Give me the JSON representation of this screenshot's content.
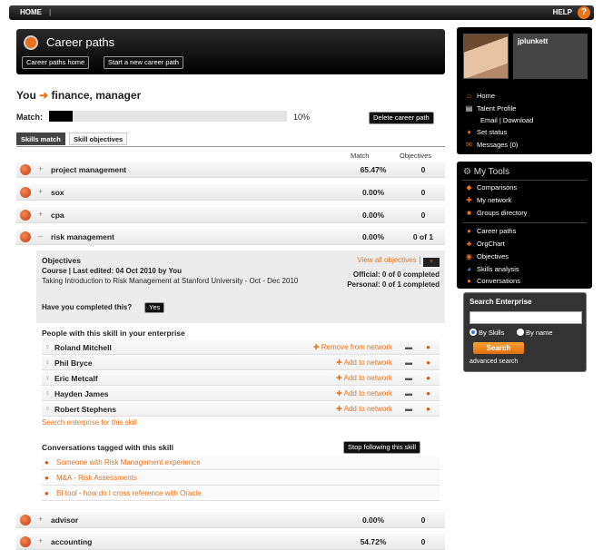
{
  "topbar": {
    "home": "HOME",
    "help": "HELP",
    "help_icon": "?"
  },
  "career": {
    "title": "Career paths",
    "btn_home": "Career paths home",
    "btn_new": "Start a new career path"
  },
  "you": {
    "label": "You",
    "arrow": "➜",
    "role": "finance, manager"
  },
  "match": {
    "label": "Match:",
    "percent": "10%",
    "fraction": 0.1,
    "delete_btn": "Delete career path"
  },
  "tabs": {
    "skills_match": "Skills match",
    "skill_objectives": "Skill objectives"
  },
  "columns": {
    "match": "Match",
    "objectives": "Objectives"
  },
  "skills_top": [
    {
      "pm": "+",
      "name": "project management",
      "match": "65.47%",
      "obj": "0"
    },
    {
      "pm": "+",
      "name": "sox",
      "match": "0.00%",
      "obj": "0"
    },
    {
      "pm": "+",
      "name": "cpa",
      "match": "0.00%",
      "obj": "0"
    },
    {
      "pm": "–",
      "name": "risk management",
      "match": "0.00%",
      "obj": "0 of 1"
    }
  ],
  "objectives": {
    "title": "Objectives",
    "view_all": "View all objectives",
    "view_sep": "|",
    "course_line": "Course | Last edited: 04 Oct 2010 by You",
    "desc": "Taking Introduction to Risk Management at Stanford University - Oct - Dec 2010",
    "official": "Official: 0 of 0 completed",
    "personal": "Personal: 0 of 1 completed",
    "question": "Have you completed this?",
    "yes_btn": "Yes"
  },
  "people": {
    "title": "People with this skill in your enterprise",
    "list": [
      {
        "name": "Roland Mitchell",
        "action": "Remove from network"
      },
      {
        "name": "Phil Bryce",
        "action": "Add to network"
      },
      {
        "name": "Eric Metcalf",
        "action": "Add to network"
      },
      {
        "name": "Hayden James",
        "action": "Add to network"
      },
      {
        "name": "Robert Stephens",
        "action": "Add to network"
      }
    ],
    "search_link": "Search enterprise for this skill"
  },
  "conversations": {
    "title": "Conversations tagged with this skill",
    "stop_btn": "Stop following this skill",
    "list": [
      "Someone with Risk Management experience",
      "M&A - Risk Assessments",
      "BI tool - how do I cross reference with Oracle"
    ]
  },
  "skills_bottom": [
    {
      "pm": "+",
      "name": "advisor",
      "match": "0.00%",
      "obj": "0"
    },
    {
      "pm": "+",
      "name": "accounting",
      "match": "54.72%",
      "obj": "0"
    }
  ],
  "profile": {
    "username": "jplunkett",
    "home": "Home",
    "talent": "Talent Profile",
    "email": "Email",
    "email_sep": "|",
    "download": "Download",
    "set_status": "Set status",
    "messages": "Messages (0)"
  },
  "tools": {
    "title": "My Tools",
    "items_a": [
      "Comparisons",
      "My network",
      "Groups directory"
    ],
    "items_b": [
      "Career paths",
      "OrgChart",
      "Objectives",
      "Skills analysis",
      "Conversations"
    ]
  },
  "search": {
    "title": "Search Enterprise",
    "by_skills": "By Skills",
    "by_name": "By name",
    "button": "Search",
    "advanced": "advanced search"
  }
}
